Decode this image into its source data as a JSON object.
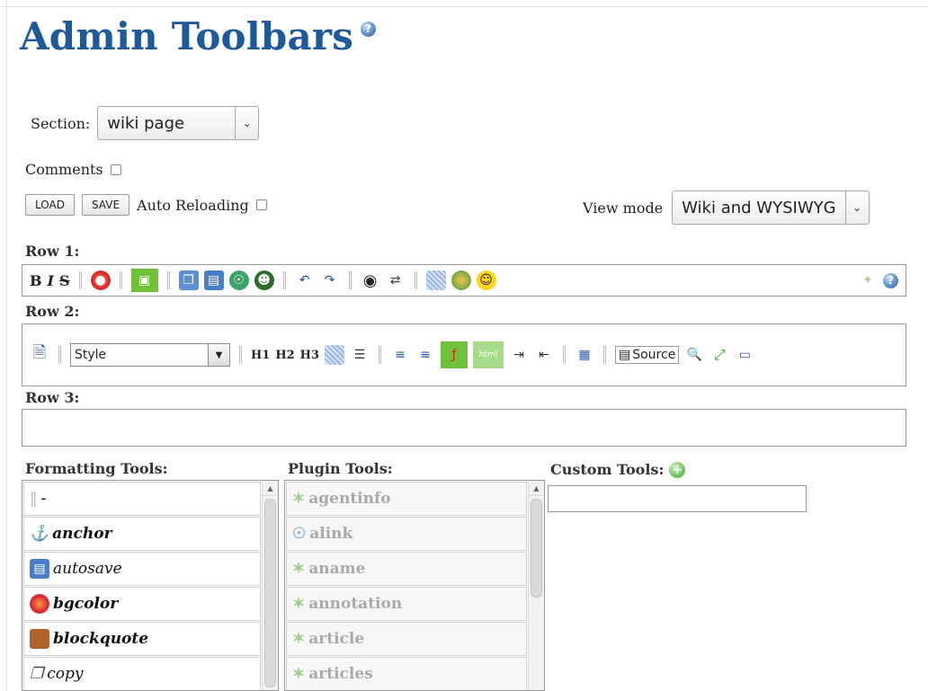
{
  "page": {
    "title": "Admin Toolbars"
  },
  "section": {
    "label": "Section:",
    "value": "wiki page"
  },
  "comments": {
    "label": "Comments"
  },
  "buttons": {
    "load": "LOAD",
    "save": "SAVE"
  },
  "auto_reloading": {
    "label": "Auto Reloading"
  },
  "view_mode": {
    "label": "View mode",
    "value": "Wiki and WYSIWYG"
  },
  "rows": {
    "row1": "Row 1:",
    "row2": "Row 2:",
    "row3": "Row 3:"
  },
  "row1_text": {
    "bold": "B",
    "italic": "I",
    "strike": "S"
  },
  "row2_text": {
    "style_value": "Style",
    "h1": "H1",
    "h2": "H2",
    "h3": "H3",
    "source": "Source"
  },
  "panels": {
    "formatting_label": "Formatting Tools:",
    "plugin_label": "Plugin Tools:",
    "custom_label": "Custom Tools:"
  },
  "formatting_tools": [
    {
      "label": "-",
      "icon": "separator-icon"
    },
    {
      "label": "anchor",
      "icon": "anchor-icon"
    },
    {
      "label": "autosave",
      "icon": "floppy-icon"
    },
    {
      "label": "bgcolor",
      "icon": "palette-icon"
    },
    {
      "label": "blockquote",
      "icon": "blockquote-icon"
    },
    {
      "label": "copy",
      "icon": "copy-icon"
    }
  ],
  "plugin_tools": [
    {
      "label": "agentinfo"
    },
    {
      "label": "alink"
    },
    {
      "label": "aname"
    },
    {
      "label": "annotation"
    },
    {
      "label": "article"
    },
    {
      "label": "articles"
    }
  ],
  "colors": {
    "title": "#1e5a9a",
    "accent_green": "#5cb82b"
  }
}
